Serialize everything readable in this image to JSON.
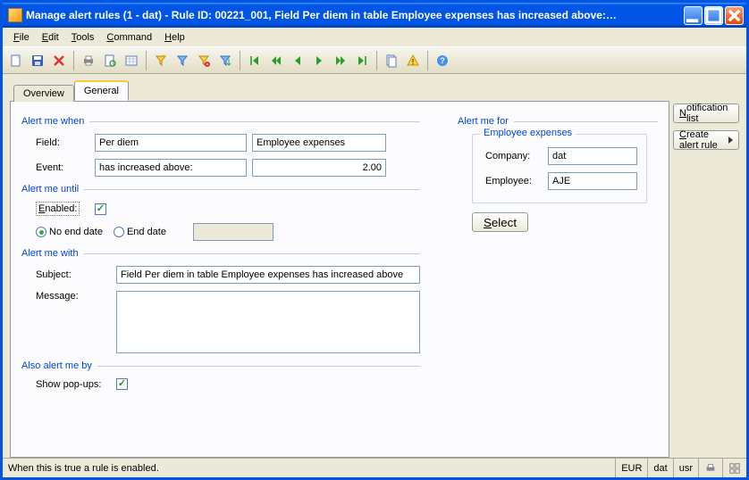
{
  "window": {
    "title": "Manage alert rules (1 - dat) - Rule ID: 00221_001, Field Per diem in table Employee expenses has increased above:…"
  },
  "menu": {
    "file": "File",
    "edit": "Edit",
    "tools": "Tools",
    "command": "Command",
    "help": "Help"
  },
  "tabs": {
    "overview": "Overview",
    "general": "General"
  },
  "sidebar": {
    "notification_list": "Notification list",
    "create_alert": "Create alert rule"
  },
  "groups": {
    "when": "Alert me when",
    "until": "Alert me until",
    "with": "Alert me with",
    "also": "Also alert me by",
    "for": "Alert me for"
  },
  "when": {
    "field_label": "Field:",
    "field_value": "Per diem",
    "table_value": "Employee expenses",
    "event_label": "Event:",
    "event_value": "has increased above:",
    "threshold_value": "2.00"
  },
  "until": {
    "enabled_label": "Enabled:",
    "no_end_date": "No end date",
    "end_date": "End date",
    "end_date_value": ""
  },
  "with": {
    "subject_label": "Subject:",
    "subject_value": "Field Per diem in table Employee expenses has increased above",
    "message_label": "Message:",
    "message_value": ""
  },
  "also": {
    "show_popups_label": "Show pop-ups:"
  },
  "for": {
    "group_title": "Employee expenses",
    "company_label": "Company:",
    "company_value": "dat",
    "employee_label": "Employee:",
    "employee_value": "AJE",
    "select_btn": "Select"
  },
  "status": {
    "hint": "When this is true a rule is enabled.",
    "currency": "EUR",
    "company": "dat",
    "user": "usr"
  }
}
